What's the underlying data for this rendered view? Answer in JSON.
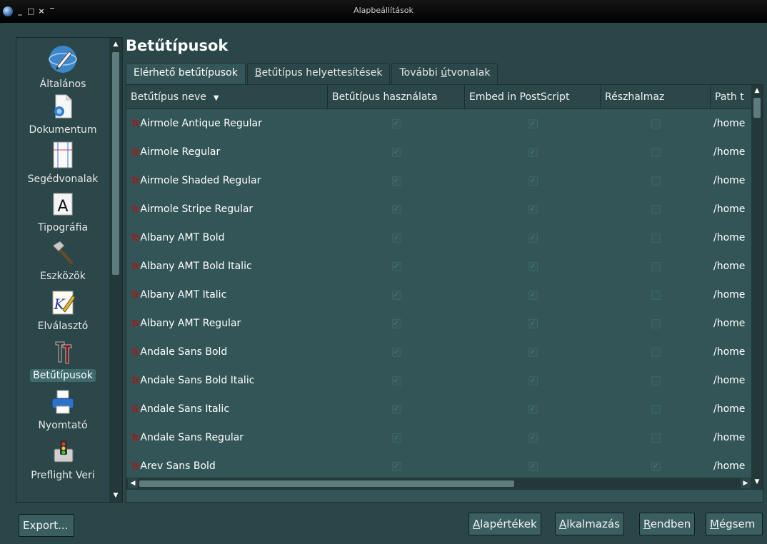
{
  "window": {
    "title": "Alapbeállítások",
    "controls": [
      "_",
      "□",
      "×",
      "‾"
    ]
  },
  "sidebar": {
    "items": [
      {
        "label": "Általános",
        "icon": "globe-pen-icon"
      },
      {
        "label": "Dokumentum",
        "icon": "document-icon"
      },
      {
        "label": "Segédvonalak",
        "icon": "guides-icon"
      },
      {
        "label": "Tipográfia",
        "icon": "letter-a-icon"
      },
      {
        "label": "Eszközök",
        "icon": "hammer-icon"
      },
      {
        "label": "Elválasztó",
        "icon": "hyphenator-icon"
      },
      {
        "label": "Betűtípusok",
        "icon": "fonts-icon"
      },
      {
        "label": "Nyomtató",
        "icon": "printer-icon"
      },
      {
        "label": "Preflight Veri",
        "icon": "traffic-light-icon"
      }
    ],
    "active_index": 6
  },
  "main": {
    "heading": "Betűtípusok",
    "tabs": [
      {
        "label": "Elérhető betűtípusok",
        "active": true
      },
      {
        "label_pre": "",
        "label_u": "B",
        "label_post": "etűtípus helyettesítések",
        "active": false
      },
      {
        "label_pre": "További ",
        "label_u": "ú",
        "label_post": "tvonalak",
        "active": false
      }
    ],
    "table": {
      "columns": [
        "Betűtípus neve",
        "Betűtípus használata",
        "Embed in PostScript",
        "Részhalmaz",
        "Path t"
      ],
      "sort_indicator": "▼",
      "rows": [
        {
          "name": "Airmole Antique Regular",
          "use": true,
          "embed": true,
          "subset": false,
          "path": "/home"
        },
        {
          "name": "Airmole Regular",
          "use": true,
          "embed": true,
          "subset": false,
          "path": "/home"
        },
        {
          "name": "Airmole Shaded Regular",
          "use": true,
          "embed": true,
          "subset": false,
          "path": "/home"
        },
        {
          "name": "Airmole Stripe Regular",
          "use": true,
          "embed": true,
          "subset": false,
          "path": "/home"
        },
        {
          "name": "Albany AMT Bold",
          "use": true,
          "embed": true,
          "subset": false,
          "path": "/home"
        },
        {
          "name": "Albany AMT Bold Italic",
          "use": true,
          "embed": true,
          "subset": false,
          "path": "/home"
        },
        {
          "name": "Albany AMT Italic",
          "use": true,
          "embed": true,
          "subset": false,
          "path": "/home"
        },
        {
          "name": "Albany AMT Regular",
          "use": true,
          "embed": true,
          "subset": false,
          "path": "/home"
        },
        {
          "name": "Andale Sans Bold",
          "use": true,
          "embed": true,
          "subset": false,
          "path": "/home"
        },
        {
          "name": "Andale Sans Bold Italic",
          "use": true,
          "embed": true,
          "subset": false,
          "path": "/home"
        },
        {
          "name": "Andale Sans Italic",
          "use": true,
          "embed": true,
          "subset": false,
          "path": "/home"
        },
        {
          "name": "Andale Sans Regular",
          "use": true,
          "embed": true,
          "subset": false,
          "path": "/home"
        },
        {
          "name": "Arev Sans Bold",
          "use": true,
          "embed": true,
          "subset": true,
          "path": "/home"
        }
      ]
    }
  },
  "buttons": {
    "export": "Export...",
    "defaults": {
      "u": "A",
      "rest": "lapértékek"
    },
    "apply": {
      "u": "A",
      "rest": "lkalmazás"
    },
    "ok": {
      "u": "R",
      "rest": "endben"
    },
    "cancel": {
      "u": "M",
      "rest": "égsem"
    }
  },
  "colors": {
    "background": "#2b4648",
    "panel": "#335557",
    "font_icon": "#a41a1a"
  }
}
